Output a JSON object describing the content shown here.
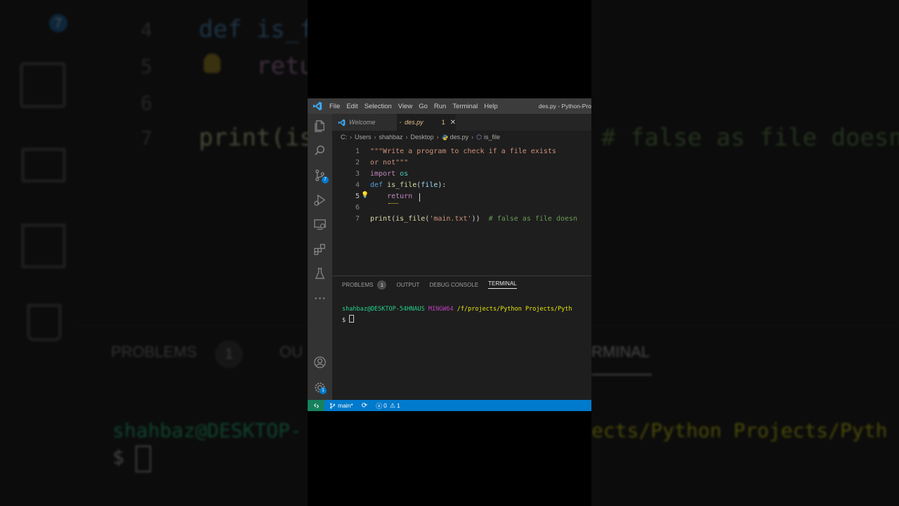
{
  "background": {
    "line_numbers": [
      "4",
      "5",
      "6",
      "7"
    ],
    "code_def": "def is_f",
    "code_return": "retu",
    "code_print": "print(is",
    "code_comment": "# false as file doesn",
    "panel_problems": "PROBLEMS",
    "panel_problems_badge": "1",
    "panel_output_fragment": "OU",
    "panel_terminal_fragment": "RMINAL",
    "terminal_user_fragment": "shahbaz@DESKTOP-",
    "terminal_path_fragment": "ects/Python Projects/Pyth",
    "terminal_prompt": "$"
  },
  "titlebar": {
    "menu": [
      "File",
      "Edit",
      "Selection",
      "View",
      "Go",
      "Run",
      "Terminal",
      "Help"
    ],
    "window_title": "des.py - Python-Pro"
  },
  "activity_bar": {
    "icons": [
      "explorer-icon",
      "search-icon",
      "source-control-icon",
      "run-debug-icon",
      "remote-explorer-icon",
      "extensions-icon",
      "testing-icon",
      "more-icon",
      "account-icon",
      "settings-icon"
    ],
    "source_control_badge": "7",
    "settings_badge": "1"
  },
  "tabs": {
    "welcome": "Welcome",
    "active_file": "des.py",
    "active_problems": "1"
  },
  "breadcrumb": [
    "C:",
    "Users",
    "shahbaz",
    "Desktop",
    "des.py",
    "is_file"
  ],
  "editor": {
    "lines": [
      {
        "n": "1",
        "parts": [
          {
            "t": "\"\"\"Write a program to check if a file exists",
            "c": "str"
          }
        ]
      },
      {
        "n": "2",
        "parts": [
          {
            "t": "or not\"\"\"",
            "c": "str"
          }
        ]
      },
      {
        "n": "3",
        "parts": [
          {
            "t": "import",
            "c": "kw"
          },
          {
            "t": " os",
            "c": "mod"
          }
        ]
      },
      {
        "n": "4",
        "parts": [
          {
            "t": "def",
            "c": "def"
          },
          {
            "t": " ",
            "c": "plain"
          },
          {
            "t": "is_file",
            "c": "fn"
          },
          {
            "t": "(",
            "c": "plain"
          },
          {
            "t": "file",
            "c": "param"
          },
          {
            "t": "):",
            "c": "plain"
          }
        ]
      },
      {
        "n": "5",
        "parts": [
          {
            "t": "    return",
            "c": "kw"
          }
        ]
      },
      {
        "n": "6",
        "parts": []
      },
      {
        "n": "7",
        "parts": [
          {
            "t": "print",
            "c": "fn"
          },
          {
            "t": "(",
            "c": "plain"
          },
          {
            "t": "is_file",
            "c": "fn"
          },
          {
            "t": "(",
            "c": "plain"
          },
          {
            "t": "'main.txt'",
            "c": "str"
          },
          {
            "t": "))  ",
            "c": "plain"
          },
          {
            "t": "# false as file doesn",
            "c": "cmt"
          }
        ]
      }
    ],
    "active_line": "5"
  },
  "panel": {
    "tabs": [
      "PROBLEMS",
      "OUTPUT",
      "DEBUG CONSOLE",
      "TERMINAL"
    ],
    "problems_count": "1",
    "active_tab": "TERMINAL",
    "terminal": {
      "user": "shahbaz@DESKTOP-54HNAUS",
      "shell": "MINGW64",
      "path": "/f/projects/Python Projects/Pyth",
      "prompt": "$"
    }
  },
  "statusbar": {
    "branch": "main*",
    "errors": "0",
    "warnings": "1"
  },
  "colors": {
    "statusbar": "#007acc",
    "remote": "#16825d",
    "titlebar": "#3c3c3c",
    "editor_bg": "#1e1e1e",
    "terminal_user": "#23d18b",
    "terminal_shell": "#bc3fbc",
    "terminal_path": "#e5e510"
  }
}
